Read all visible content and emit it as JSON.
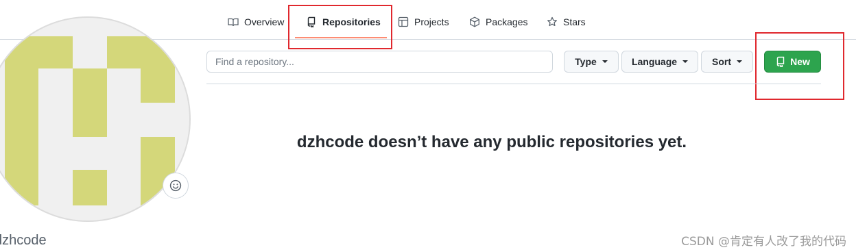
{
  "nav": {
    "tabs": [
      {
        "label": "Overview",
        "icon": "book-icon"
      },
      {
        "label": "Repositories",
        "icon": "repo-icon",
        "active": true
      },
      {
        "label": "Projects",
        "icon": "table-icon"
      },
      {
        "label": "Packages",
        "icon": "package-icon"
      },
      {
        "label": "Stars",
        "icon": "star-icon"
      }
    ],
    "active_underline_color": "#fd8c73"
  },
  "profile": {
    "username": "dzhcode",
    "avatar_colors": {
      "background": "#f0f0f0",
      "blocks": "#d4d77a"
    },
    "status_icon": "smiley-icon"
  },
  "filters": {
    "search_placeholder": "Find a repository...",
    "type_label": "Type",
    "language_label": "Language",
    "sort_label": "Sort",
    "new_label": "New",
    "new_color": "#2da44e"
  },
  "empty_message": "dzhcode doesn’t have any public repositories yet.",
  "watermark": "CSDN @肯定有人改了我的代码",
  "annotation_color": "#e0282e"
}
